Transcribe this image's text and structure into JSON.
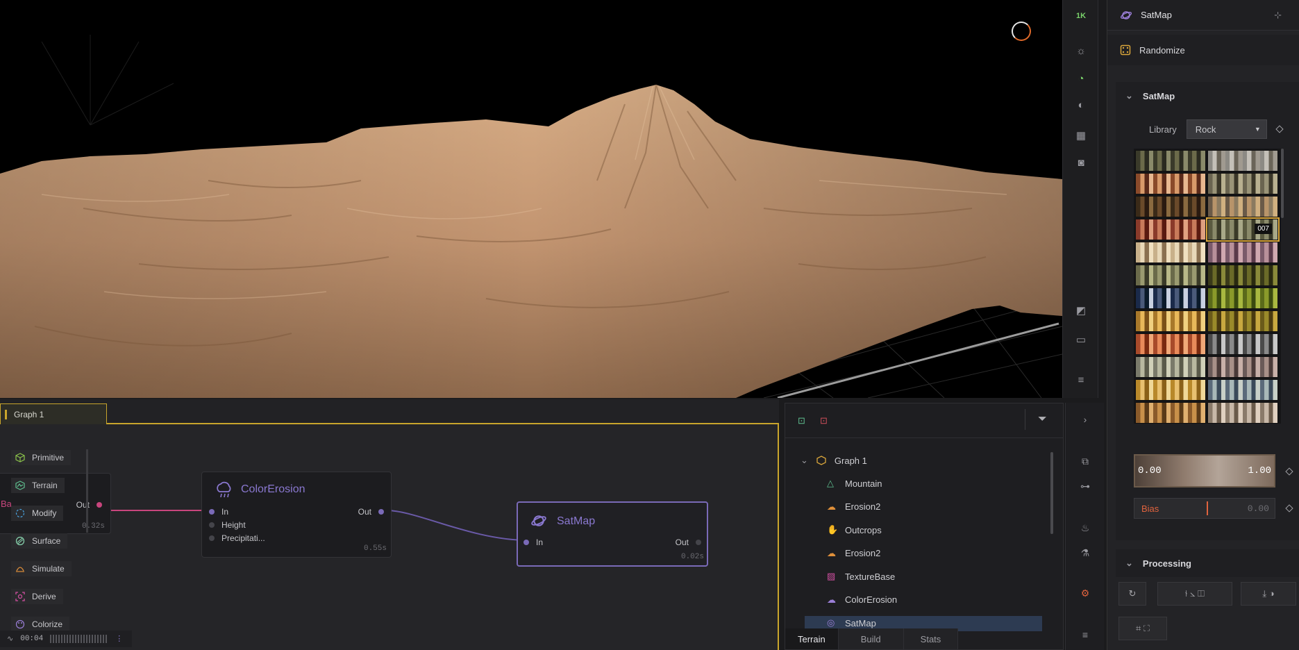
{
  "viewport": {
    "resolution_label": "1K"
  },
  "properties": {
    "node_name": "SatMap",
    "randomize_label": "Randomize",
    "section_title": "SatMap",
    "library_label": "Library",
    "library_value": "Rock",
    "selected_swatch_tag": "007",
    "range_min": "0.00",
    "range_max": "1.00",
    "bias_label": "Bias",
    "bias_value": "0.00",
    "processing_title": "Processing"
  },
  "graph": {
    "tab_label": "Graph 1",
    "palette": [
      {
        "label": "Primitive",
        "color": "#8bc34a",
        "icon": "cube-icon"
      },
      {
        "label": "Terrain",
        "color": "#5fbf8f",
        "icon": "mountain-icon"
      },
      {
        "label": "Modify",
        "color": "#4aa3df",
        "icon": "modify-icon"
      },
      {
        "label": "Surface",
        "color": "#8ad6b0",
        "icon": "surface-icon"
      },
      {
        "label": "Simulate",
        "color": "#e0903a",
        "icon": "simulate-icon"
      },
      {
        "label": "Derive",
        "color": "#d04fa0",
        "icon": "derive-icon"
      },
      {
        "label": "Colorize",
        "color": "#9b7fd8",
        "icon": "palette-icon"
      }
    ],
    "nodes": {
      "partial": {
        "prefix": "Ba",
        "out": "Out",
        "timing": "0.32s"
      },
      "color_erosion": {
        "title": "ColorErosion",
        "inputs": [
          "In",
          "Height",
          "Precipitati..."
        ],
        "out": "Out",
        "timing": "0.55s"
      },
      "satmap": {
        "title": "SatMap",
        "input": "In",
        "out": "Out",
        "timing": "0.02s"
      }
    },
    "status_time": "00:04"
  },
  "outliner": {
    "root": "Graph 1",
    "items": [
      {
        "label": "Mountain",
        "color": "#5fbf8f",
        "icon": "mountain-icon"
      },
      {
        "label": "Erosion2",
        "color": "#e0903a",
        "icon": "erosion-icon"
      },
      {
        "label": "Outcrops",
        "color": "#8ad6b0",
        "icon": "outcrops-icon"
      },
      {
        "label": "Erosion2",
        "color": "#e0903a",
        "icon": "erosion-icon"
      },
      {
        "label": "TextureBase",
        "color": "#d04fa0",
        "icon": "texture-icon"
      },
      {
        "label": "ColorErosion",
        "color": "#9b7fd8",
        "icon": "color-erosion-icon"
      },
      {
        "label": "SatMap",
        "color": "#9b7fd8",
        "icon": "satmap-icon"
      }
    ],
    "tabs": [
      "Terrain",
      "Build",
      "Stats"
    ]
  },
  "colors": {
    "accent_gold": "#c9a52c",
    "node_purple": "#7a6ab8",
    "link_pink": "#c8457d",
    "bias_orange": "#e0633e"
  }
}
